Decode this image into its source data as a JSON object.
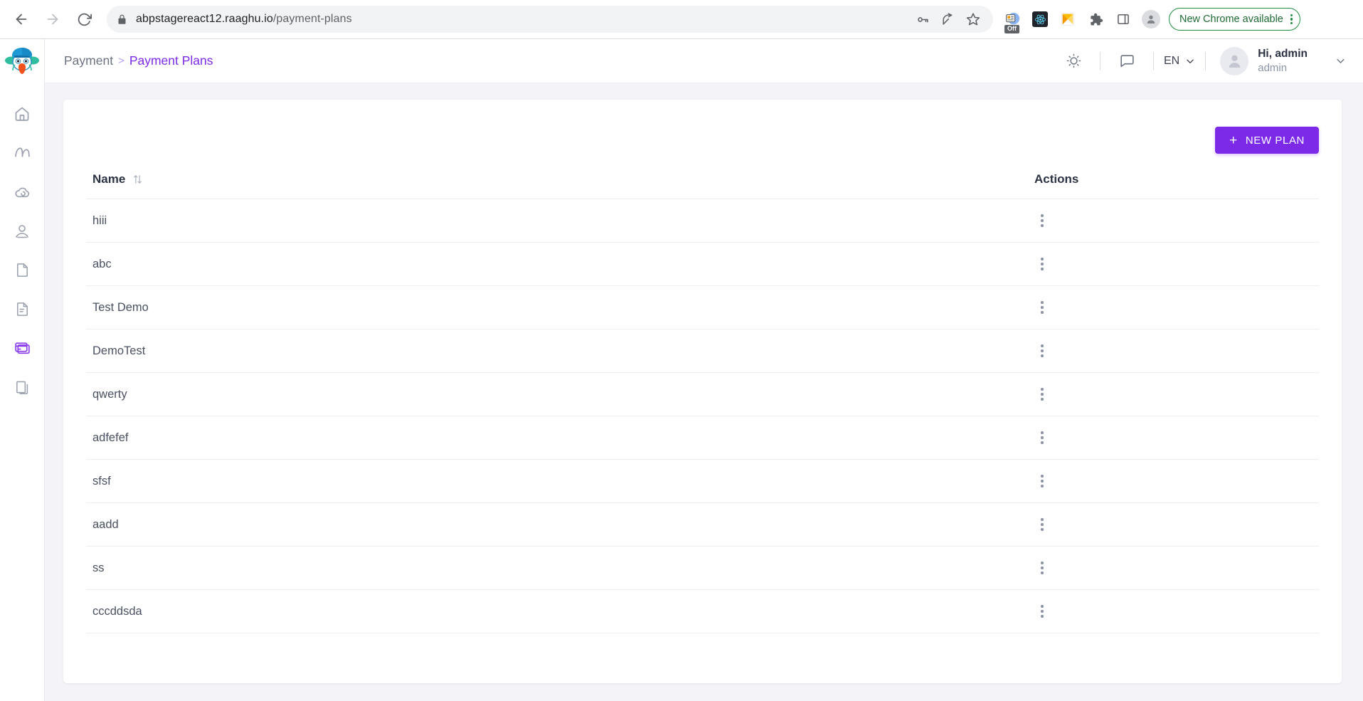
{
  "browser": {
    "back_icon": "arrow-left-icon",
    "forward_icon": "arrow-right-icon",
    "reload_icon": "reload-icon",
    "lock_icon": "lock-icon",
    "url_host": "abpstagereact12.raaghu.io",
    "url_path": "/payment-plans",
    "omnibox_icons": [
      "password-key-icon",
      "share-icon",
      "bookmark-star-icon"
    ],
    "extensions": [
      {
        "name": "extension-toggle-off",
        "badge": "Off"
      },
      {
        "name": "react-devtools-icon"
      },
      {
        "name": "extension-orange-icon"
      },
      {
        "name": "extensions-puzzle-icon"
      },
      {
        "name": "side-panel-icon"
      },
      {
        "name": "profile-avatar-icon"
      }
    ],
    "update_pill": "New Chrome available",
    "menu_icon": "chrome-menu-icon"
  },
  "sidebar": {
    "logo_name": "raaghu-bird-logo",
    "items": [
      {
        "name": "sidebar-item-home",
        "icon": "home-icon",
        "active": false
      },
      {
        "name": "sidebar-item-analytics",
        "icon": "analytics-icon",
        "active": false
      },
      {
        "name": "sidebar-item-cloud",
        "icon": "cloud-icon",
        "active": false
      },
      {
        "name": "sidebar-item-user",
        "icon": "user-icon",
        "active": false
      },
      {
        "name": "sidebar-item-document",
        "icon": "document-icon",
        "active": false
      },
      {
        "name": "sidebar-item-file-text",
        "icon": "file-text-icon",
        "active": false
      },
      {
        "name": "sidebar-item-payment",
        "icon": "credit-card-icon",
        "active": true
      },
      {
        "name": "sidebar-item-pages",
        "icon": "pages-copy-icon",
        "active": false
      }
    ]
  },
  "header": {
    "breadcrumb_parent": "Payment",
    "breadcrumb_separator": ">",
    "breadcrumb_current": "Payment Plans",
    "theme_icon": "brightness-sun-icon",
    "chat_icon": "chat-bubble-icon",
    "language": "EN",
    "language_caret_icon": "chevron-down-icon",
    "user_greeting": "Hi, admin",
    "user_name": "admin",
    "user_caret_icon": "chevron-down-icon"
  },
  "main": {
    "new_plan_label": "NEW PLAN",
    "new_plan_plus": "+",
    "columns": [
      "Name",
      "Actions"
    ],
    "sort_icon": "sort-arrows-icon",
    "row_action_icon": "vertical-dots-icon",
    "rows": [
      {
        "name": "hiii"
      },
      {
        "name": "abc"
      },
      {
        "name": "Test Demo"
      },
      {
        "name": "DemoTest"
      },
      {
        "name": "qwerty"
      },
      {
        "name": "adfefef"
      },
      {
        "name": "sfsf"
      },
      {
        "name": "aadd"
      },
      {
        "name": "ss"
      },
      {
        "name": "cccddsda"
      }
    ]
  },
  "colors": {
    "accent_purple": "#7c2ae8",
    "sidebar_active": "#8b3dec",
    "page_background": "#f4f4f8",
    "chrome_green": "#1e8e3e"
  }
}
